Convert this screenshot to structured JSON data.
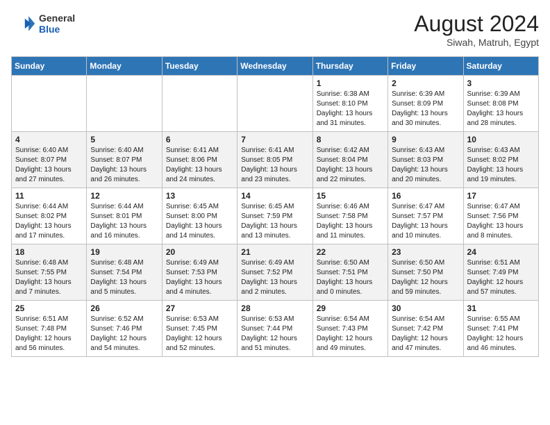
{
  "header": {
    "logo_general": "General",
    "logo_blue": "Blue",
    "title": "August 2024",
    "subtitle": "Siwah, Matruh, Egypt"
  },
  "days_of_week": [
    "Sunday",
    "Monday",
    "Tuesday",
    "Wednesday",
    "Thursday",
    "Friday",
    "Saturday"
  ],
  "weeks": [
    [
      {
        "day": "",
        "info": ""
      },
      {
        "day": "",
        "info": ""
      },
      {
        "day": "",
        "info": ""
      },
      {
        "day": "",
        "info": ""
      },
      {
        "day": "1",
        "info": "Sunrise: 6:38 AM\nSunset: 8:10 PM\nDaylight: 13 hours and 31 minutes."
      },
      {
        "day": "2",
        "info": "Sunrise: 6:39 AM\nSunset: 8:09 PM\nDaylight: 13 hours and 30 minutes."
      },
      {
        "day": "3",
        "info": "Sunrise: 6:39 AM\nSunset: 8:08 PM\nDaylight: 13 hours and 28 minutes."
      }
    ],
    [
      {
        "day": "4",
        "info": "Sunrise: 6:40 AM\nSunset: 8:07 PM\nDaylight: 13 hours and 27 minutes."
      },
      {
        "day": "5",
        "info": "Sunrise: 6:40 AM\nSunset: 8:07 PM\nDaylight: 13 hours and 26 minutes."
      },
      {
        "day": "6",
        "info": "Sunrise: 6:41 AM\nSunset: 8:06 PM\nDaylight: 13 hours and 24 minutes."
      },
      {
        "day": "7",
        "info": "Sunrise: 6:41 AM\nSunset: 8:05 PM\nDaylight: 13 hours and 23 minutes."
      },
      {
        "day": "8",
        "info": "Sunrise: 6:42 AM\nSunset: 8:04 PM\nDaylight: 13 hours and 22 minutes."
      },
      {
        "day": "9",
        "info": "Sunrise: 6:43 AM\nSunset: 8:03 PM\nDaylight: 13 hours and 20 minutes."
      },
      {
        "day": "10",
        "info": "Sunrise: 6:43 AM\nSunset: 8:02 PM\nDaylight: 13 hours and 19 minutes."
      }
    ],
    [
      {
        "day": "11",
        "info": "Sunrise: 6:44 AM\nSunset: 8:02 PM\nDaylight: 13 hours and 17 minutes."
      },
      {
        "day": "12",
        "info": "Sunrise: 6:44 AM\nSunset: 8:01 PM\nDaylight: 13 hours and 16 minutes."
      },
      {
        "day": "13",
        "info": "Sunrise: 6:45 AM\nSunset: 8:00 PM\nDaylight: 13 hours and 14 minutes."
      },
      {
        "day": "14",
        "info": "Sunrise: 6:45 AM\nSunset: 7:59 PM\nDaylight: 13 hours and 13 minutes."
      },
      {
        "day": "15",
        "info": "Sunrise: 6:46 AM\nSunset: 7:58 PM\nDaylight: 13 hours and 11 minutes."
      },
      {
        "day": "16",
        "info": "Sunrise: 6:47 AM\nSunset: 7:57 PM\nDaylight: 13 hours and 10 minutes."
      },
      {
        "day": "17",
        "info": "Sunrise: 6:47 AM\nSunset: 7:56 PM\nDaylight: 13 hours and 8 minutes."
      }
    ],
    [
      {
        "day": "18",
        "info": "Sunrise: 6:48 AM\nSunset: 7:55 PM\nDaylight: 13 hours and 7 minutes."
      },
      {
        "day": "19",
        "info": "Sunrise: 6:48 AM\nSunset: 7:54 PM\nDaylight: 13 hours and 5 minutes."
      },
      {
        "day": "20",
        "info": "Sunrise: 6:49 AM\nSunset: 7:53 PM\nDaylight: 13 hours and 4 minutes."
      },
      {
        "day": "21",
        "info": "Sunrise: 6:49 AM\nSunset: 7:52 PM\nDaylight: 13 hours and 2 minutes."
      },
      {
        "day": "22",
        "info": "Sunrise: 6:50 AM\nSunset: 7:51 PM\nDaylight: 13 hours and 0 minutes."
      },
      {
        "day": "23",
        "info": "Sunrise: 6:50 AM\nSunset: 7:50 PM\nDaylight: 12 hours and 59 minutes."
      },
      {
        "day": "24",
        "info": "Sunrise: 6:51 AM\nSunset: 7:49 PM\nDaylight: 12 hours and 57 minutes."
      }
    ],
    [
      {
        "day": "25",
        "info": "Sunrise: 6:51 AM\nSunset: 7:48 PM\nDaylight: 12 hours and 56 minutes."
      },
      {
        "day": "26",
        "info": "Sunrise: 6:52 AM\nSunset: 7:46 PM\nDaylight: 12 hours and 54 minutes."
      },
      {
        "day": "27",
        "info": "Sunrise: 6:53 AM\nSunset: 7:45 PM\nDaylight: 12 hours and 52 minutes."
      },
      {
        "day": "28",
        "info": "Sunrise: 6:53 AM\nSunset: 7:44 PM\nDaylight: 12 hours and 51 minutes."
      },
      {
        "day": "29",
        "info": "Sunrise: 6:54 AM\nSunset: 7:43 PM\nDaylight: 12 hours and 49 minutes."
      },
      {
        "day": "30",
        "info": "Sunrise: 6:54 AM\nSunset: 7:42 PM\nDaylight: 12 hours and 47 minutes."
      },
      {
        "day": "31",
        "info": "Sunrise: 6:55 AM\nSunset: 7:41 PM\nDaylight: 12 hours and 46 minutes."
      }
    ]
  ]
}
